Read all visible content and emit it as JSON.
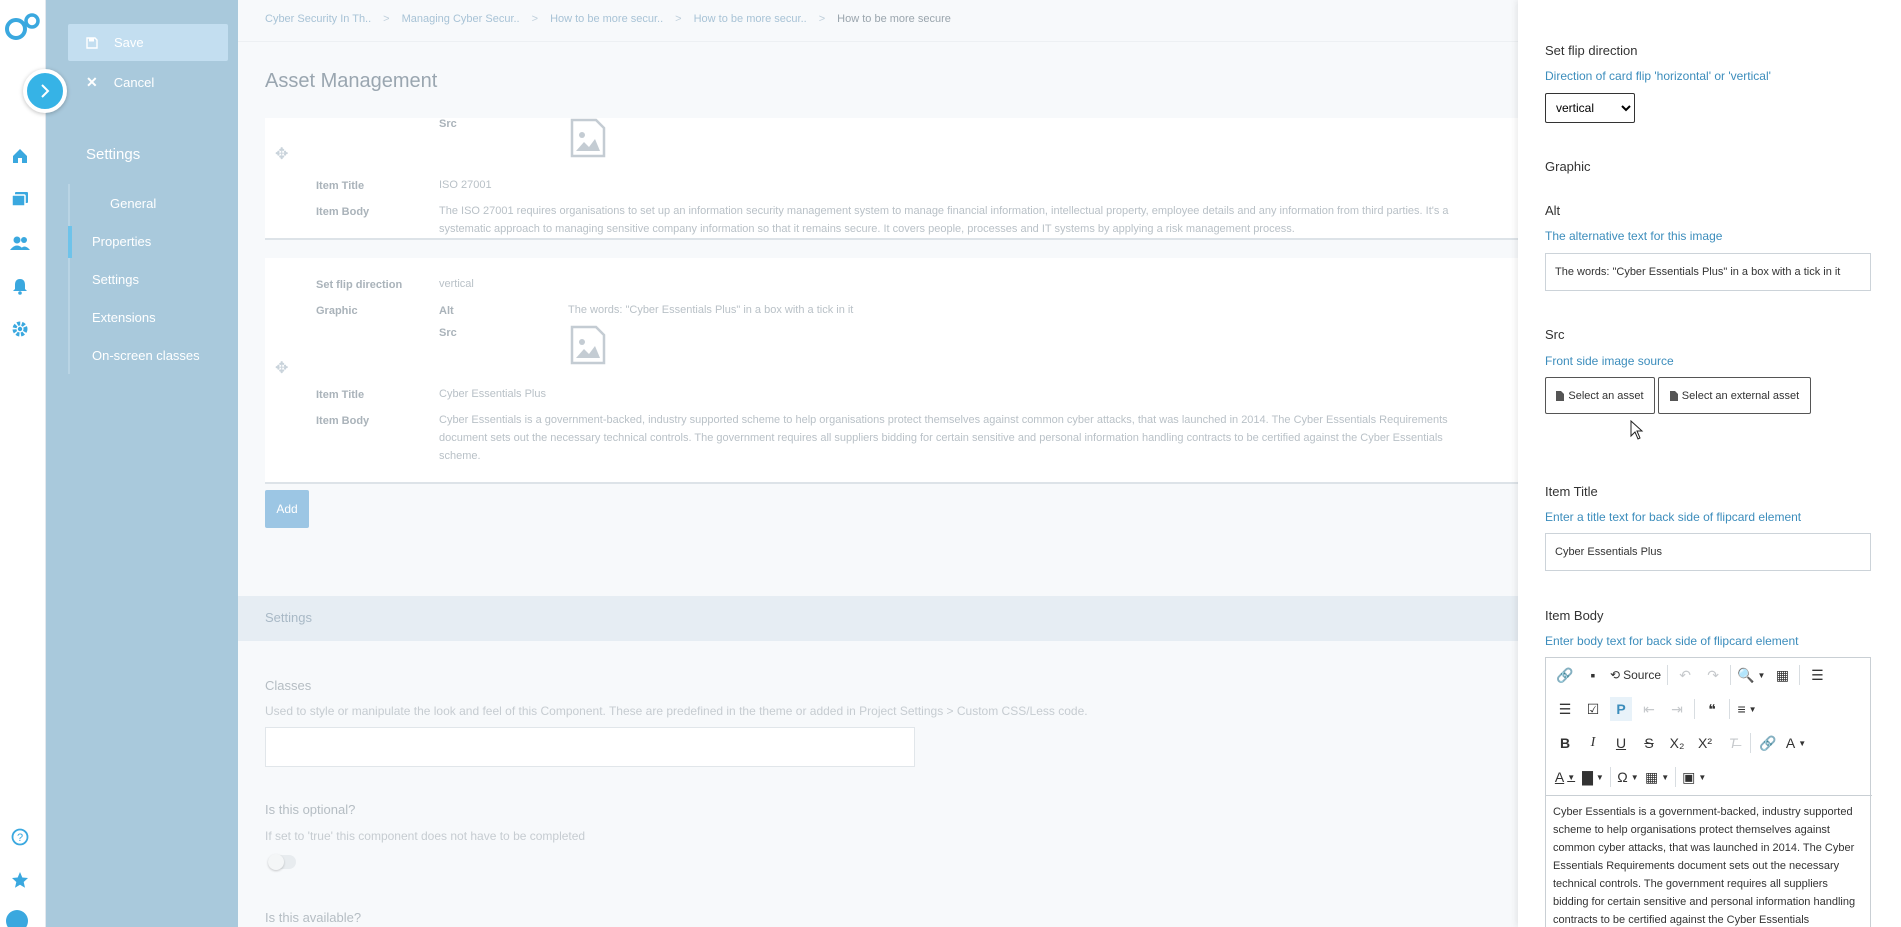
{
  "toolbar": {
    "save_label": "Save",
    "cancel_label": "Cancel"
  },
  "nav": {
    "heading": "Settings",
    "items": [
      "General",
      "Properties",
      "Settings",
      "Extensions",
      "On-screen classes"
    ]
  },
  "breadcrumbs": [
    "Cyber Security In Th..",
    "Managing Cyber Secur..",
    "How to be more secur..",
    "How to be more secur..",
    "How to be more secure"
  ],
  "page_title": "Asset Management",
  "items": [
    {
      "src_label": "Src",
      "item_title_label": "Item Title",
      "item_title": "ISO 27001",
      "item_body_label": "Item Body",
      "item_body": "The ISO 27001 requires organisations to set up an information security management system to manage financial information, intellectual property, employee details and any information from third parties. It's a systematic approach to managing sensitive company information so that it remains secure. It covers people, processes and IT systems by applying a risk management process."
    },
    {
      "flip_label": "Set flip direction",
      "flip_value": "vertical",
      "graphic_label": "Graphic",
      "alt_label": "Alt",
      "alt_value": "The words: \"Cyber Essentials Plus\" in a box with a tick in it",
      "src_label": "Src",
      "item_title_label": "Item Title",
      "item_title": "Cyber Essentials Plus",
      "item_body_label": "Item Body",
      "item_body": "Cyber Essentials is a government-backed, industry supported scheme to help organisations protect themselves against common cyber attacks, that was launched in 2014. The Cyber Essentials Requirements document sets out the necessary technical controls. The government requires all suppliers bidding for certain sensitive and personal information handling contracts to be certified against the Cyber Essentials scheme."
    }
  ],
  "add_label": "Add",
  "settings": {
    "bar_label": "Settings",
    "classes_title": "Classes",
    "classes_help": "Used to style or manipulate the look and feel of this Component. These are predefined in the theme or added in Project Settings > Custom CSS/Less code.",
    "optional_title": "Is this optional?",
    "optional_help": "If set to 'true' this component does not have to be completed",
    "available_title": "Is this available?"
  },
  "panel": {
    "flip_title": "Set flip direction",
    "flip_help": "Direction of card flip 'horizontal' or 'vertical'",
    "flip_selected": "vertical",
    "graphic_title": "Graphic",
    "alt_title": "Alt",
    "alt_help": "The alternative text for this image",
    "alt_value": "The words: \"Cyber Essentials Plus\" in a box with a tick in it",
    "src_title": "Src",
    "src_help": "Front side image source",
    "select_asset": "Select an asset",
    "select_external": "Select an external asset",
    "item_title": "Item Title",
    "item_title_help": "Enter a title text for back side of flipcard element",
    "item_title_value": "Cyber Essentials Plus",
    "item_body": "Item Body",
    "item_body_help": "Enter body text for back side of flipcard element",
    "source_label": "Source",
    "editor_text": "Cyber Essentials is a government-backed, industry supported scheme to help organisations protect themselves against common cyber attacks, that was launched in 2014. The Cyber Essentials Requirements document sets out the necessary technical controls. The government requires all suppliers bidding for certain sensitive and personal information handling contracts to be certified against the Cyber Essentials"
  },
  "colors": {
    "accent": "#36b3e6",
    "nav_bg": "#a9c9dc",
    "link": "#3c8dbc"
  }
}
